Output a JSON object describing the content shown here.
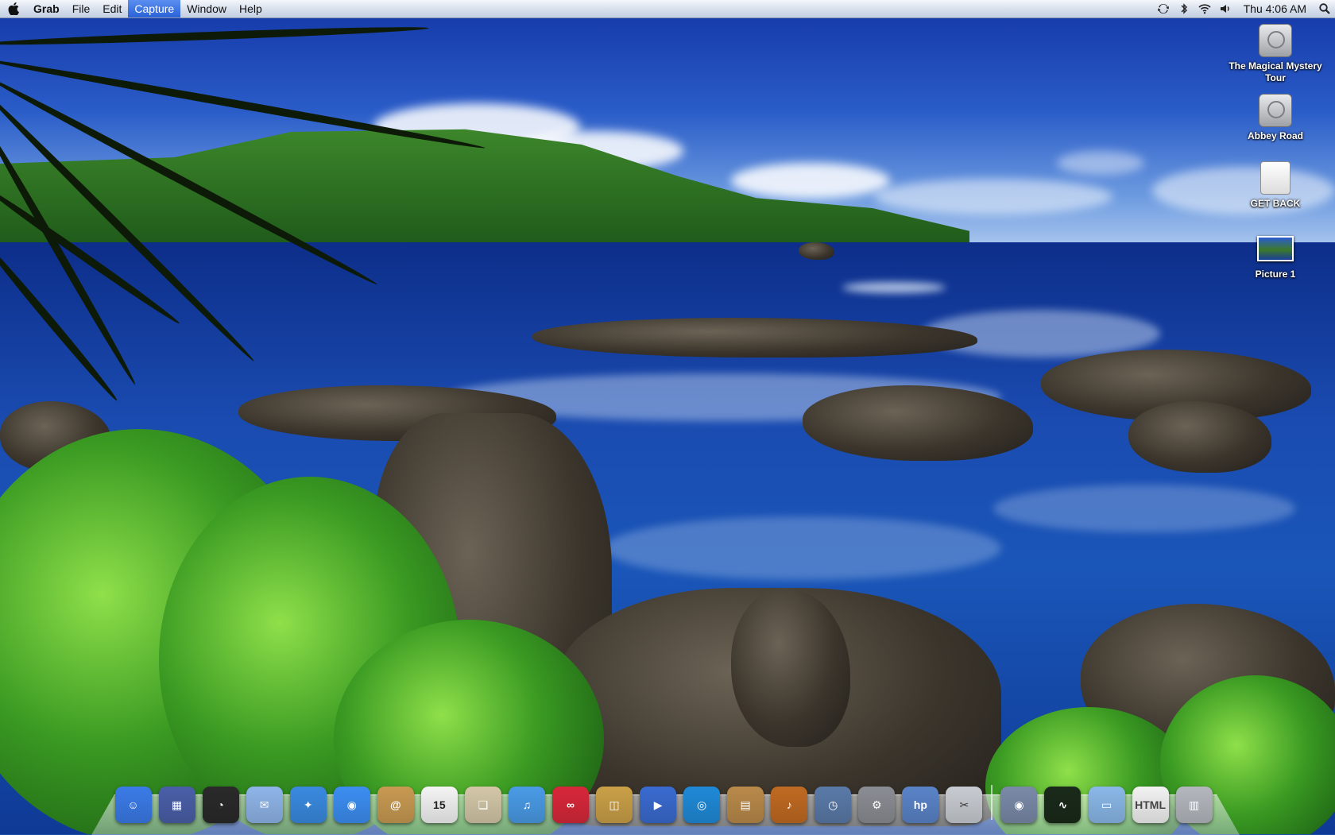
{
  "menubar": {
    "app_name": "Grab",
    "menus": [
      "File",
      "Edit",
      "Capture",
      "Window",
      "Help"
    ],
    "active_menu": "Capture",
    "clock": "Thu 4:06 AM",
    "status_icons": [
      "sync-icon",
      "bluetooth-icon",
      "wifi-icon",
      "volume-icon",
      "spotlight-icon"
    ]
  },
  "desktop": {
    "icons": [
      {
        "label": "The Magical Mystery Tour",
        "icon": "hard-disk-icon"
      },
      {
        "label": "Abbey Road",
        "icon": "hard-disk-icon"
      },
      {
        "label": "GET BACK",
        "icon": "external-disk-icon"
      },
      {
        "label": "Picture 1",
        "icon": "image-file-icon"
      }
    ]
  },
  "dock": {
    "apps": [
      {
        "name": "finder-icon",
        "color": "#3b7be8",
        "glyph": "☺"
      },
      {
        "name": "spaces-icon",
        "color": "#4a5fa8",
        "glyph": "▦"
      },
      {
        "name": "dashboard-icon",
        "color": "#2a2a2a",
        "glyph": "◔"
      },
      {
        "name": "mail-icon",
        "color": "#8fb5e8",
        "glyph": "✉"
      },
      {
        "name": "safari-icon",
        "color": "#3a8ae0",
        "glyph": "✦"
      },
      {
        "name": "ichat-icon",
        "color": "#3c8ef2",
        "glyph": "◉"
      },
      {
        "name": "address-book-icon",
        "color": "#c89a52",
        "glyph": "@"
      },
      {
        "name": "ical-icon",
        "color": "#f4f4f4",
        "glyph": "15",
        "text_color": "#222"
      },
      {
        "name": "preview-icon",
        "color": "#d4c7a8",
        "glyph": "❏"
      },
      {
        "name": "itunes-icon",
        "color": "#4a9be6",
        "glyph": "♫"
      },
      {
        "name": "lastfm-icon",
        "color": "#d7283a",
        "glyph": "∞"
      },
      {
        "name": "iphoto-icon",
        "color": "#caa048",
        "glyph": "◫"
      },
      {
        "name": "imovie-icon",
        "color": "#3a6bd0",
        "glyph": "▶"
      },
      {
        "name": "idvd-icon",
        "color": "#1f8ad8",
        "glyph": "◎"
      },
      {
        "name": "iweb-icon",
        "color": "#b98a4a",
        "glyph": "▤"
      },
      {
        "name": "garageband-icon",
        "color": "#c06a22",
        "glyph": "♪"
      },
      {
        "name": "time-machine-icon",
        "color": "#5a7aa8",
        "glyph": "◷"
      },
      {
        "name": "system-preferences-icon",
        "color": "#8a8d93",
        "glyph": "⚙"
      },
      {
        "name": "hp-printer-icon",
        "color": "#5a84c8",
        "glyph": "hp"
      },
      {
        "name": "grab-icon",
        "color": "#c8ccd2",
        "glyph": "✂",
        "text_color": "#333"
      }
    ],
    "others": [
      {
        "name": "network-utility-icon",
        "color": "#7a8aa8",
        "glyph": "◉"
      },
      {
        "name": "activity-monitor-icon",
        "color": "#1a2a1a",
        "glyph": "∿"
      },
      {
        "name": "applications-folder-icon",
        "color": "#8ab8e8",
        "glyph": "▭"
      },
      {
        "name": "html-document-icon",
        "color": "#f2f2f2",
        "glyph": "HTML",
        "text_color": "#444"
      },
      {
        "name": "trash-icon",
        "color": "#b4b8be",
        "glyph": "▥"
      }
    ]
  }
}
